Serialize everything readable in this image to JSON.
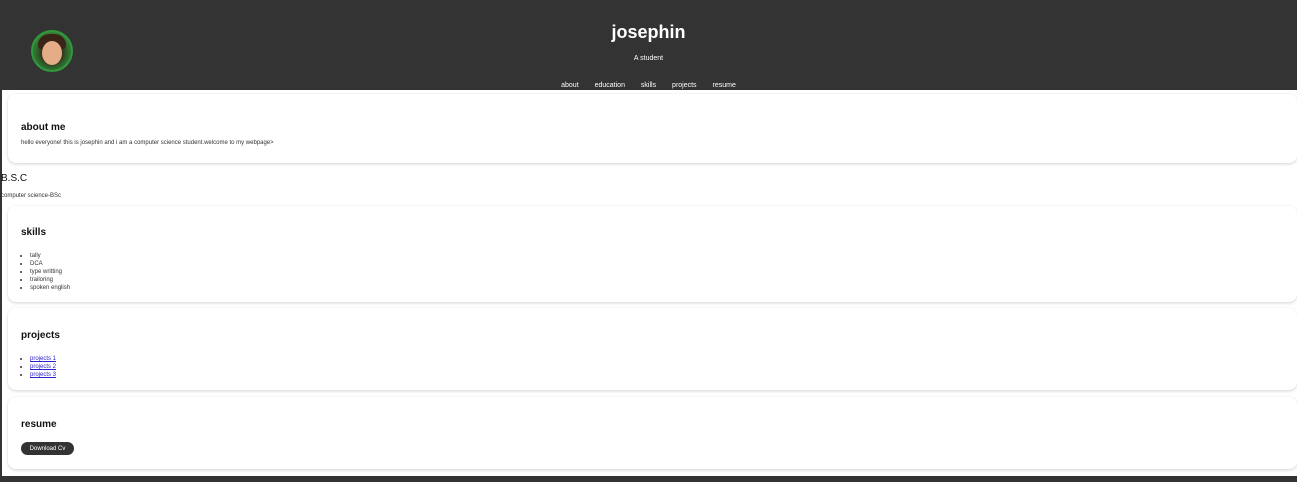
{
  "header": {
    "title": "josephin",
    "subtitle": "A student",
    "nav": [
      "about",
      "education",
      "skills",
      "projects",
      "resume"
    ],
    "avatar_icon": "profile-photo"
  },
  "about": {
    "heading": "about me",
    "text": "hello everyone! this is josephin and i am a computer science student.welcome to my webpage>"
  },
  "education": {
    "heading": "B.S.C",
    "text": "computer science-BSc"
  },
  "skills": {
    "heading": "skills",
    "items": [
      "tally",
      "DCA",
      "type writting",
      "trailoring",
      "spoken english"
    ]
  },
  "projects": {
    "heading": "projects",
    "items": [
      "projects 1",
      "projects 2",
      "projects 3"
    ]
  },
  "resume": {
    "heading": "resume",
    "button_label": "Download Cv"
  },
  "colors": {
    "header_bg": "#333333",
    "card_bg": "#ffffff",
    "link": "#2a22cc"
  }
}
